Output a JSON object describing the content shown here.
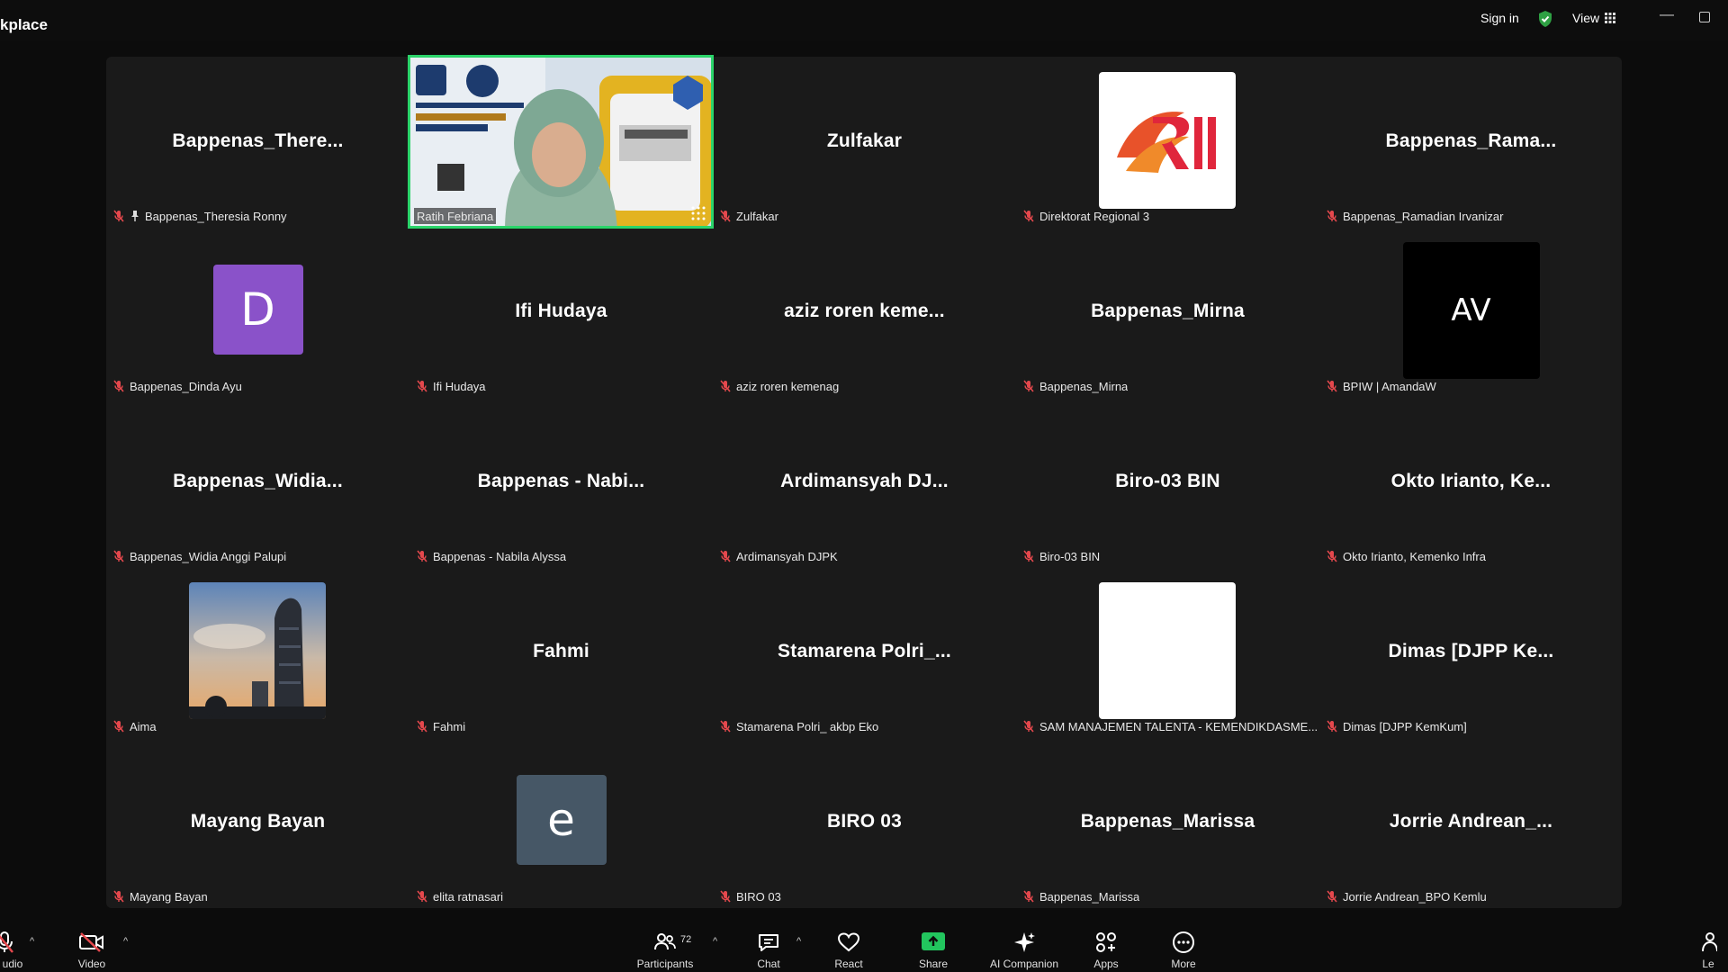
{
  "window": {
    "title": "kplace",
    "sign_in": "Sign in",
    "view": "View",
    "minimize": "—"
  },
  "tiles": [
    {
      "name": "Bappenas_There...",
      "label": "Bappenas_Theresia Ronny",
      "pinned": true
    },
    {
      "name": "",
      "label": "Ratih Febriana",
      "video": true
    },
    {
      "name": "Zulfakar",
      "label": "Zulfakar"
    },
    {
      "name": "",
      "label": "Direktorat Regional 3",
      "avatar": "logo"
    },
    {
      "name": "Bappenas_Rama...",
      "label": "Bappenas_Ramadian Irvanizar"
    },
    {
      "name": "",
      "label": "Bappenas_Dinda Ayu",
      "avatar_letter": "D",
      "avatar_color": "#8a52c9"
    },
    {
      "name": "Ifi Hudaya",
      "label": "Ifi Hudaya"
    },
    {
      "name": "aziz roren keme...",
      "label": "aziz roren kemenag"
    },
    {
      "name": "Bappenas_Mirna",
      "label": "Bappenas_Mirna"
    },
    {
      "name": "",
      "label": "BPIW | AmandaW",
      "avatar_letter": "AV",
      "avatar_color": "#000000"
    },
    {
      "name": "Bappenas_Widia...",
      "label": "Bappenas_Widia Anggi Palupi"
    },
    {
      "name": "Bappenas - Nabi...",
      "label": "Bappenas - Nabila Alyssa"
    },
    {
      "name": "Ardimansyah  DJ...",
      "label": "Ardimansyah DJPK"
    },
    {
      "name": "Biro-03 BIN",
      "label": "Biro-03 BIN"
    },
    {
      "name": "Okto Irianto, Ke...",
      "label": "Okto Irianto, Kemenko Infra"
    },
    {
      "name": "",
      "label": "Aima",
      "avatar": "photo"
    },
    {
      "name": "Fahmi",
      "label": "Fahmi"
    },
    {
      "name": "Stamarena  Polri_...",
      "label": "Stamarena Polri_ akbp Eko"
    },
    {
      "name": "",
      "label": "SAM MANAJEMEN TALENTA - KEMENDIKDASME...",
      "avatar": "blank"
    },
    {
      "name": "Dimas [DJPP Ke...",
      "label": "Dimas [DJPP KemKum]"
    },
    {
      "name": "Mayang Bayan",
      "label": "Mayang Bayan"
    },
    {
      "name": "",
      "label": "elita ratnasari",
      "avatar_letter": "e",
      "avatar_color": "#465766"
    },
    {
      "name": "BIRO 03",
      "label": "BIRO 03"
    },
    {
      "name": "Bappenas_Marissa",
      "label": "Bappenas_Marissa"
    },
    {
      "name": "Jorrie  Andrean_...",
      "label": "Jorrie Andrean_BPO Kemlu"
    }
  ],
  "toolbar": {
    "audio": "udio",
    "video": "Video",
    "participants": "Participants",
    "participants_count": "72",
    "chat": "Chat",
    "react": "React",
    "share": "Share",
    "ai_companion": "AI Companion",
    "apps": "Apps",
    "more": "More",
    "leave": "Le"
  },
  "colors": {
    "share_green": "#22c55e",
    "active_speaker": "#2bd46a",
    "muted_red": "#e5484d",
    "shield_green": "#2ea043"
  }
}
